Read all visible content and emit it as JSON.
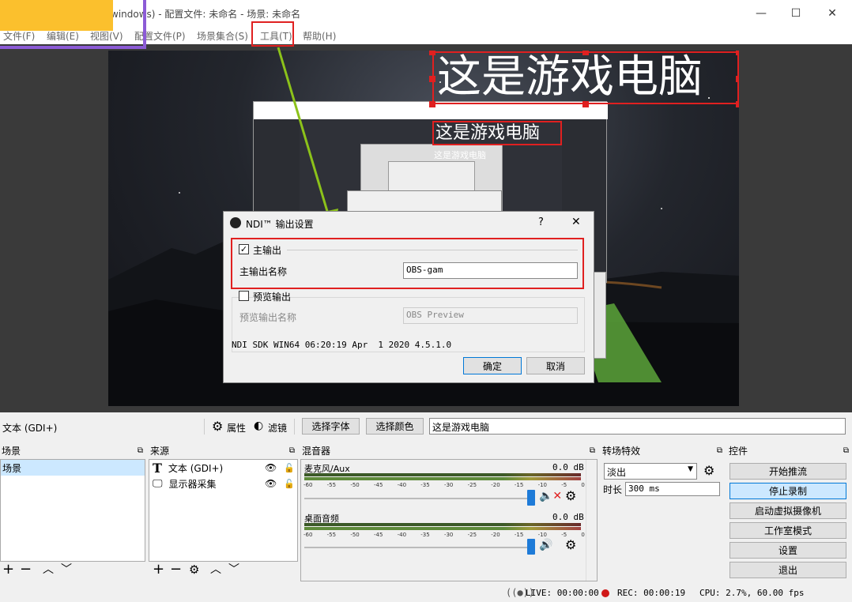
{
  "window": {
    "title": "windows) - 配置文件: 未命名 - 场景: 未命名",
    "controls": [
      "—",
      "☐",
      "✕"
    ]
  },
  "menu": [
    "文件(F)",
    "编辑(E)",
    "视图(V)",
    "配置文件(P)",
    "场景集合(S)",
    "工具(T)",
    "帮助(H)"
  ],
  "preview": {
    "big_text": "这是游戏电脑",
    "nested_text": "这是游戏电脑",
    "nested_small_text": "这是游戏电脑"
  },
  "ndi_dialog": {
    "title": "NDI™ 输出设置",
    "help": "?",
    "close": "✕",
    "main_output_label": "主输出",
    "main_output_checked": "✓",
    "main_output_name_label": "主输出名称",
    "main_output_name_value": "OBS-gam",
    "preview_output_label": "预览输出",
    "preview_output_name_label": "预览输出名称",
    "preview_output_name_value": "OBS Preview",
    "version": "NDI SDK WIN64 06:20:19 Apr  1 2020 4.5.1.0",
    "ok": "确定",
    "cancel": "取消"
  },
  "source_toolbar": {
    "selected_source": "文本 (GDI+)",
    "properties": "属性",
    "filters": "滤镜",
    "select_font": "选择字体",
    "select_color": "选择颜色",
    "text_value": "这是游戏电脑"
  },
  "docks": {
    "scenes": {
      "title": "场景",
      "items": [
        "场景"
      ]
    },
    "sources": {
      "title": "来源",
      "items": [
        {
          "label": "文本 (GDI+)",
          "icon": "text-source-icon"
        },
        {
          "label": "显示器采集",
          "icon": "monitor-icon"
        }
      ]
    },
    "mixer": {
      "title": "混音器",
      "tracks": [
        {
          "name": "麦克风/Aux",
          "db": "0.0 dB",
          "muted": true
        },
        {
          "name": "桌面音频",
          "db": "0.0 dB",
          "muted": false
        }
      ],
      "ticks": [
        "-60",
        "-55",
        "-50",
        "-45",
        "-40",
        "-35",
        "-30",
        "-25",
        "-20",
        "-15",
        "-10",
        "-5",
        "0"
      ]
    },
    "transitions": {
      "title": "转场特效",
      "selected": "淡出",
      "duration_label": "时长",
      "duration": "300 ms"
    },
    "controls": {
      "title": "控件",
      "buttons": [
        "开始推流",
        "停止录制",
        "启动虚拟摄像机",
        "工作室模式",
        "设置",
        "退出"
      ]
    }
  },
  "status": {
    "live": "LIVE: 00:00:00",
    "rec": "REC: 00:00:19",
    "cpu": "CPU: 2.7%, 60.00 fps"
  },
  "colors": {
    "accent_red": "#e02020",
    "arrow_green": "#8cc21a",
    "slider_blue": "#1e7bd8"
  }
}
